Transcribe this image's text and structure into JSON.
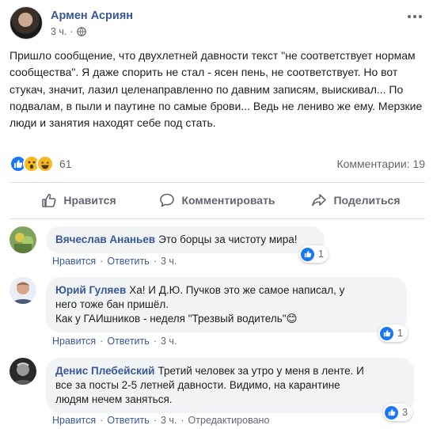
{
  "post": {
    "author": "Армен Асриян",
    "time": "3 ч.",
    "text": "Пришло сообщение, что двухлетней давности текст \"не соответствует нормам сообщества\". Я даже спорить не стал - ясен пень, не соответствует. Но вот стукач, значит, лазил целенаправленно по давним записям, выискивал... По подвалам, в пыли и паутине по самые брови... Ведь не лениво же ему. Мерзкие люди и занятия находят себе под стать.",
    "reactions_count": "61",
    "comments_label": "Комментарии: 19",
    "reaction_types": [
      "like",
      "wow",
      "haha"
    ]
  },
  "actions": {
    "like": "Нравится",
    "comment": "Комментировать",
    "share": "Поделиться"
  },
  "comments": [
    {
      "author": "Вячеслав Ананьев",
      "text": "Это борцы за чистоту мира!",
      "like": "Нравится",
      "reply": "Ответить",
      "time": "3 ч.",
      "reactions": "1"
    },
    {
      "author": "Юрий Гуляев",
      "text": "Ха! И Д.Ю. Пучков это же самое написал, у\nнего тоже бан пришёл.\nКак у ГАИшников - неделя \"Трезвый водитель\"😊",
      "like": "Нравится",
      "reply": "Ответить",
      "time": "3 ч.",
      "reactions": "1"
    },
    {
      "author": "Денис Плебейский",
      "text": "Третий человек за утро у меня в ленте. И\nвсе за посты 2-5 летней давности. Видимо, на карантине\nлюдям нечем заняться.",
      "like": "Нравится",
      "reply": "Ответить",
      "time": "3 ч.",
      "edited": "Отредактировано",
      "reactions": "3"
    }
  ],
  "colors": {
    "link": "#385898",
    "like_blue": "#1877f2",
    "muted": "#606770",
    "bubble": "#f2f3f5"
  }
}
